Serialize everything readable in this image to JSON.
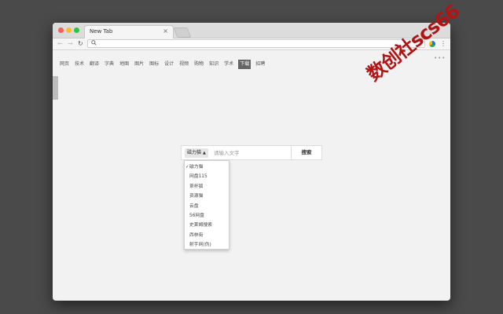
{
  "browser": {
    "tab_title": "New Tab",
    "tab_close": "×",
    "nav": {
      "back": "←",
      "forward": "→",
      "reload": "↻"
    },
    "address": "",
    "menu": "⋮"
  },
  "categories": [
    "网页",
    "技术",
    "翻译",
    "字典",
    "地图",
    "图片",
    "图标",
    "设计",
    "视频",
    "购物",
    "知识",
    "学术",
    "下载",
    "招聘"
  ],
  "active_category": "下载",
  "more": "•••",
  "search": {
    "engine_label": "磁力猫",
    "engine_caret": "▲",
    "placeholder": "请输入文字",
    "button_label": "搜索"
  },
  "dropdown": {
    "selected_mark": "✓",
    "items": [
      "磁力猫",
      "网盘115",
      "茶杯狐",
      "资源猫",
      "云盘",
      "56网盘",
      "史莱姆搜索",
      "西林街",
      "射手网(伪)"
    ]
  },
  "watermark": "数创社scs66",
  "colors": {
    "watermark": "#b31313",
    "active_category_bg": "#666666"
  }
}
